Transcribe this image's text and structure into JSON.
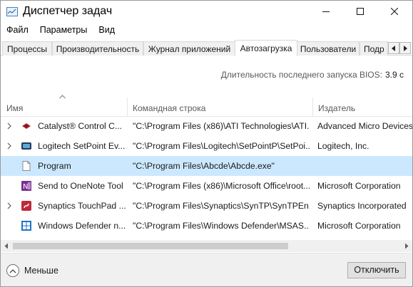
{
  "window": {
    "title": "Диспетчер задач",
    "controls": {
      "minimize": "minimize-icon",
      "maximize": "maximize-icon",
      "close": "close-icon"
    }
  },
  "menu": [
    "Файл",
    "Параметры",
    "Вид"
  ],
  "tabs": [
    {
      "label": "Процессы",
      "active": false
    },
    {
      "label": "Производительность",
      "active": false
    },
    {
      "label": "Журнал приложений",
      "active": false
    },
    {
      "label": "Автозагрузка",
      "active": true
    },
    {
      "label": "Пользователи",
      "active": false
    },
    {
      "label": "Подр",
      "active": false
    }
  ],
  "bios": {
    "label": "Длительность последнего запуска BIOS:",
    "value": "3.9 с"
  },
  "table": {
    "columns": [
      "Имя",
      "Командная строка",
      "Издатель"
    ],
    "sorted_column": "Имя",
    "rows": [
      {
        "name": "Catalyst® Control C...",
        "command": "\"C:\\Program Files (x86)\\ATI Technologies\\ATI...",
        "publisher": "Advanced Micro Devices...",
        "expandable": true,
        "icon": "catalyst-icon",
        "selected": false
      },
      {
        "name": "Logitech SetPoint Ev...",
        "command": "\"C:\\Program Files\\Logitech\\SetPointP\\SetPoi...",
        "publisher": "Logitech, Inc.",
        "expandable": true,
        "icon": "logitech-icon",
        "selected": false
      },
      {
        "name": "Program",
        "command": "\"C:\\Program Files\\Abcde\\Abcde.exe\"",
        "publisher": "",
        "expandable": false,
        "icon": "blank-file-icon",
        "selected": true
      },
      {
        "name": "Send to OneNote Tool",
        "command": "\"C:\\Program Files (x86)\\Microsoft Office\\root...",
        "publisher": "Microsoft Corporation",
        "expandable": false,
        "icon": "onenote-icon",
        "selected": false
      },
      {
        "name": "Synaptics TouchPad ...",
        "command": "\"C:\\Program Files\\Synaptics\\SynTP\\SynTPEn...",
        "publisher": "Synaptics Incorporated",
        "expandable": true,
        "icon": "synaptics-icon",
        "selected": false
      },
      {
        "name": "Windows Defender n...",
        "command": "\"C:\\Program Files\\Windows Defender\\MSAS...",
        "publisher": "Microsoft Corporation",
        "expandable": false,
        "icon": "windows-defender-icon",
        "selected": false
      }
    ]
  },
  "footer": {
    "less_label": "Меньше",
    "disable_label": "Отключить"
  },
  "colors": {
    "selection": "#cce8ff",
    "footer_bg": "#f0f0f0"
  }
}
